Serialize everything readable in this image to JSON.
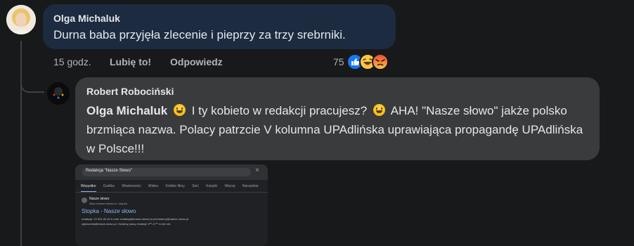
{
  "comment1": {
    "author": "Olga Michaluk",
    "text": "Durna baba przyjęła zlecenie i pieprzy za trzy srebrniki.",
    "time": "15 godz.",
    "like_label": "Lubię to!",
    "reply_label": "Odpowiedz",
    "reaction_count": "75",
    "reactions": [
      "like-icon",
      "laughing-emoji",
      "angry-emoji"
    ]
  },
  "reply": {
    "author": "Robert Robociński",
    "mention": "Olga Michaluk",
    "text_part1": "I ty kobieto w redakcji pracujesz?",
    "text_part2": "AHA! \"Nasze słowo\" jakże polsko brzmiąca nazwa. Polacy patrzcie V kolumna UPAdlińska uprawiająca propagandę UPAdlińska w Polsce!!!"
  },
  "screenshot": {
    "search_query": "Redakcja \"Nasze Słowo\"",
    "tabs": [
      "Wszystko",
      "Grafika",
      "Wiadomości",
      "Wideo",
      "Krótkie filmy",
      "Sieć",
      "Książki",
      "Więcej",
      "Narzędzia"
    ],
    "result_site": "Nasze słowo",
    "result_url": "https://nasze-slowo.pl › stopka",
    "result_title": "Stopka - Nasze słowo",
    "result_snippet1": "redakcja: 22 831 84 40 e-mail: redakcja@nasze-slowo.pl promotorzy@nasze-slowo.pl",
    "result_snippet2": "ogłoszenia@nasze-slowo.pl. Godziny pracy redakcji: 9⁰⁰-17⁰⁰ w dni rob."
  },
  "colors": {
    "background": "#18191a",
    "bubble_highlight": "#1c2b40",
    "bubble": "#3a3b3c",
    "link_blue": "#8ab4f8"
  }
}
